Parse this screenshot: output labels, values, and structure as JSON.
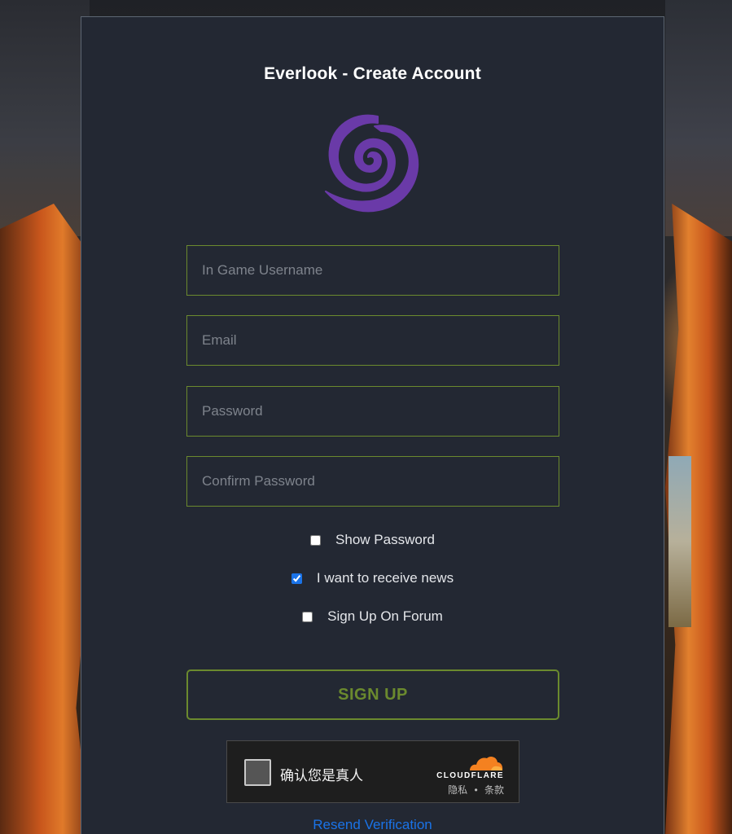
{
  "page": {
    "title": "Everlook - Create Account"
  },
  "logo": {
    "icon": "purple-swirl-logo-icon",
    "color": "#6a3aa8"
  },
  "form": {
    "username_placeholder": "In Game Username",
    "email_placeholder": "Email",
    "password_placeholder": "Password",
    "confirm_password_placeholder": "Confirm Password",
    "options": [
      {
        "label": "Show Password",
        "checked": false
      },
      {
        "label": "I want to receive news",
        "checked": true
      },
      {
        "label": "Sign Up On Forum",
        "checked": false
      }
    ],
    "submit_label": "SIGN UP"
  },
  "captcha": {
    "label": "确认您是真人",
    "brand": "CLOUDFLARE",
    "privacy_link": "隐私",
    "separator": "•",
    "terms_link": "条款",
    "brand_color": "#f48120"
  },
  "footer": {
    "resend_link": "Resend Verification"
  },
  "colors": {
    "panel_bg": "#232833",
    "accent_green": "#6b8a2e",
    "link_blue": "#1a73e8"
  }
}
